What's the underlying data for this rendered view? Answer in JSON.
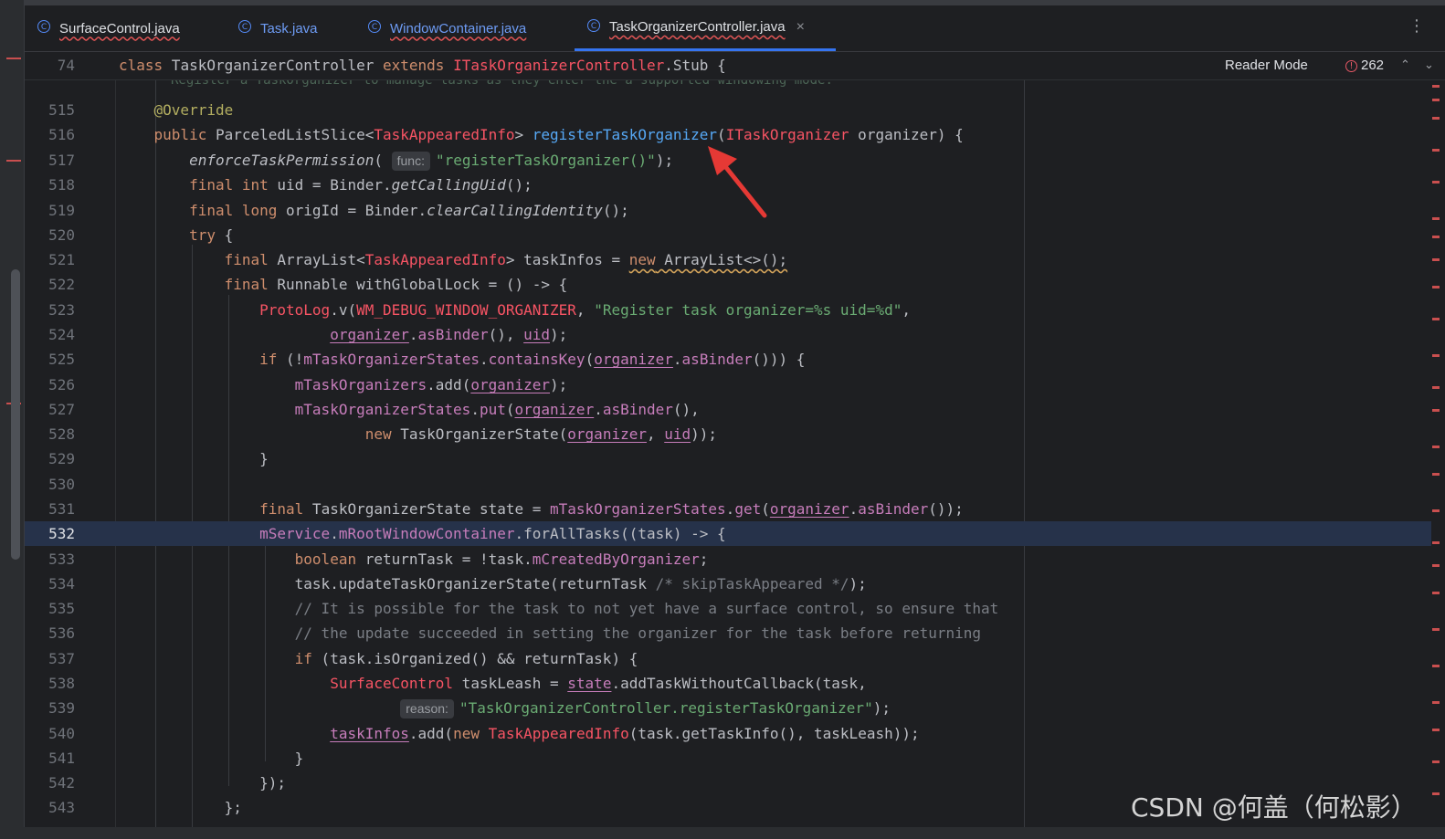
{
  "tabs": [
    {
      "label": "SurfaceControl.java",
      "icon": "class-icon"
    },
    {
      "label": "Task.java",
      "icon": "class-icon"
    },
    {
      "label": "WindowContainer.java",
      "icon": "class-icon"
    },
    {
      "label": "TaskOrganizerController.java",
      "icon": "class-icon",
      "active": true
    }
  ],
  "tab_close": "×",
  "more_menu": "⋮",
  "sticky_header": {
    "line": "74",
    "code": "class TaskOrganizerController extends ITaskOrganizerController.Stub {"
  },
  "reader_mode": "Reader Mode",
  "problems_count": "262",
  "ghost_doc": "Register a TaskOrganizer to manage tasks as they enter the a supported windowing mode.",
  "line_numbers": [
    "515",
    "516",
    "517",
    "518",
    "519",
    "520",
    "521",
    "522",
    "523",
    "524",
    "525",
    "526",
    "527",
    "528",
    "529",
    "530",
    "531",
    "532",
    "533",
    "534",
    "535",
    "536",
    "537",
    "538",
    "539",
    "540",
    "541",
    "542",
    "543"
  ],
  "current_line": "532",
  "hints": {
    "func": "func:",
    "reason": "reason:"
  },
  "watermark": "CSDN @何盖（何松影）",
  "colors": {
    "background": "#1e1f22",
    "keyword": "#cf8e6d",
    "type_error": "#f75464",
    "field": "#c77dbb",
    "string": "#6aab73",
    "method_decl": "#56a8f5",
    "current_line": "#26324a",
    "arrow": "#e53935"
  }
}
